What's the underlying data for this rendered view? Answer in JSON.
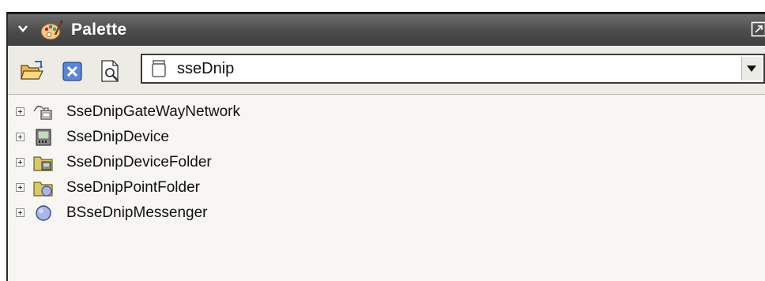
{
  "palette": {
    "title": "Palette",
    "title_icon": "palette-icon",
    "collapse_icon": "chevron-down-icon",
    "maximize_icon": "maximize-icon"
  },
  "toolbar": {
    "open_icon": "open-folder-icon",
    "close_icon": "close-box-icon",
    "find_icon": "find-document-icon",
    "module": {
      "value": "sseDnip",
      "icon": "jar-icon"
    },
    "dropdown_icon": "dropdown-arrow-icon"
  },
  "tree": {
    "items": [
      {
        "label": "SseDnipGateWayNetwork",
        "icon": "network-icon"
      },
      {
        "label": "SseDnipDevice",
        "icon": "device-icon"
      },
      {
        "label": "SseDnipDeviceFolder",
        "icon": "device-folder-icon"
      },
      {
        "label": "SseDnipPointFolder",
        "icon": "point-folder-icon"
      },
      {
        "label": "BSseDnipMessenger",
        "icon": "messenger-icon"
      }
    ]
  },
  "colors": {
    "titlebar": "#4b4b4b",
    "panel_bg": "#f4f3ef",
    "folder": "#d8c86a",
    "messenger": "#a9b6e8"
  }
}
